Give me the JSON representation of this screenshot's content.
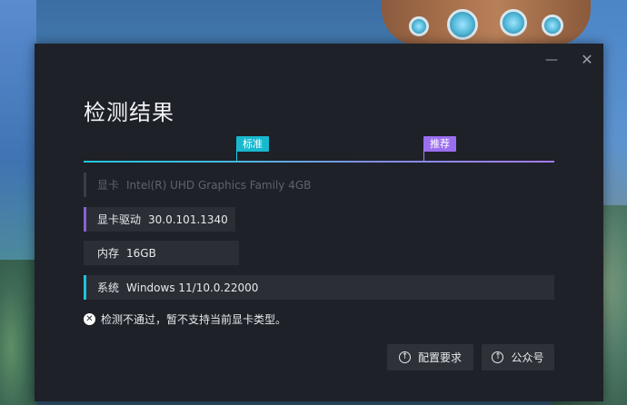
{
  "window": {
    "minimize_glyph": "—",
    "close_glyph": "✕"
  },
  "dialog": {
    "title": "检测结果"
  },
  "progress": {
    "standard_label": "标准",
    "recommended_label": "推荐"
  },
  "specs": {
    "gpu": {
      "label": "显卡",
      "value": "Intel(R) UHD Graphics Family 4GB"
    },
    "driver": {
      "label": "显卡驱动",
      "value": "30.0.101.1340"
    },
    "memory": {
      "label": "内存",
      "value": "16GB"
    },
    "os": {
      "label": "系统",
      "value": "Windows 11/10.0.22000"
    }
  },
  "error": {
    "icon": "close-circle-icon",
    "glyph": "✕",
    "message": "检测不通过，暂不支持当前显卡类型。"
  },
  "buttons": {
    "requirements": {
      "label": "配置要求",
      "icon": "arrow-up-circle-icon",
      "glyph": "↑"
    },
    "official_account": {
      "label": "公众号",
      "icon": "arrow-up-circle-icon",
      "glyph": "↑"
    }
  },
  "colors": {
    "dialog_bg": "#1e2128",
    "standard": "#17b9cf",
    "recommended": "#9b6ef0",
    "row_bg": "#2b2e35"
  }
}
